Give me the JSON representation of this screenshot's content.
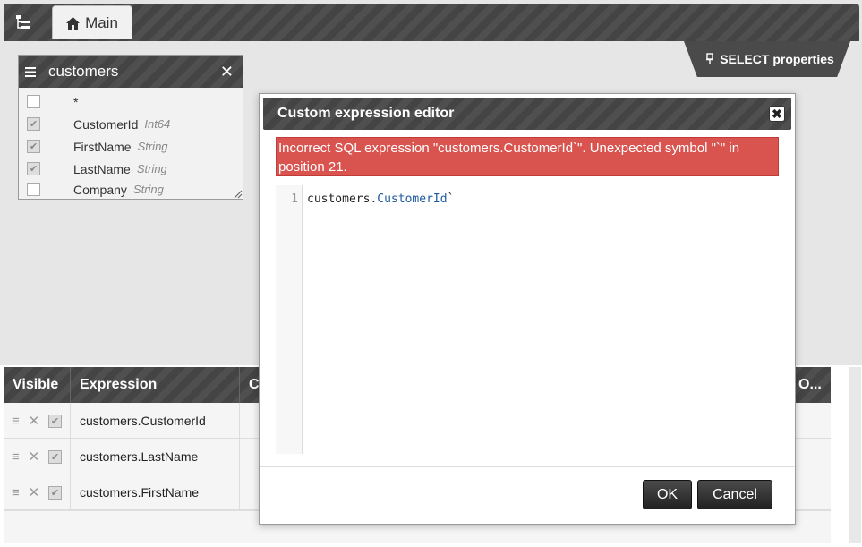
{
  "toolbar": {
    "main_tab": "Main",
    "select_properties": "SELECT properties"
  },
  "table_box": {
    "name": "customers",
    "rows": [
      {
        "label": "*",
        "type": "",
        "checked": false
      },
      {
        "label": "CustomerId",
        "type": "Int64",
        "checked": true
      },
      {
        "label": "FirstName",
        "type": "String",
        "checked": true
      },
      {
        "label": "LastName",
        "type": "String",
        "checked": true
      },
      {
        "label": "Company",
        "type": "String",
        "checked": false
      }
    ]
  },
  "grid": {
    "headers": {
      "visible": "Visible",
      "expression": "Expression",
      "c": "C",
      "o": "O..."
    },
    "rows": [
      {
        "expression": "customers.CustomerId"
      },
      {
        "expression": "customers.LastName"
      },
      {
        "expression": "customers.FirstName"
      }
    ]
  },
  "dialog": {
    "title": "Custom expression editor",
    "error": "Incorrect SQL expression \"customers.CustomerId`\". Unexpected symbol \"`\" in position 21.",
    "line_number": "1",
    "code_object": "customers",
    "code_dot": ".",
    "code_property": "CustomerId",
    "code_tail": "`",
    "ok": "OK",
    "cancel": "Cancel"
  }
}
